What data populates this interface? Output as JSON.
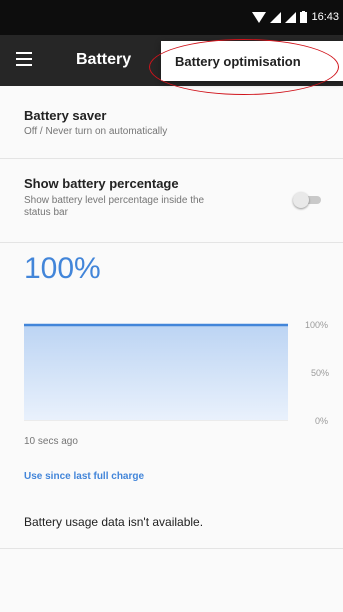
{
  "status_bar": {
    "time": "16:43",
    "icons": [
      "wifi-icon",
      "signal-icon",
      "signal-icon-2",
      "battery-icon"
    ]
  },
  "app_bar": {
    "title": "Battery",
    "menu_icon": "hamburger-menu-icon"
  },
  "overflow_menu": {
    "items": [
      {
        "label": "Battery optimisation"
      }
    ]
  },
  "preferences": [
    {
      "title": "Battery saver",
      "summary": "Off / Never turn on automatically"
    },
    {
      "title": "Show battery percentage",
      "summary_lines": [
        "Show battery level percentage inside the",
        "status bar"
      ],
      "toggle_state": "off"
    }
  ],
  "battery": {
    "level_text": "100%",
    "time_ago": "10 secs ago",
    "link": "Use since last full charge",
    "usage_message": "Battery usage data isn't available."
  },
  "chart_data": {
    "type": "area",
    "tick_labels": [
      "100%",
      "50%",
      "0%"
    ],
    "ylim": [
      0,
      100
    ],
    "series": [
      {
        "values": [
          100,
          100
        ]
      }
    ]
  },
  "colors": {
    "accent": "#4285d9",
    "highlight": "#d0131b",
    "app_bar": "#262626",
    "status_bar": "#0d0d0d"
  }
}
